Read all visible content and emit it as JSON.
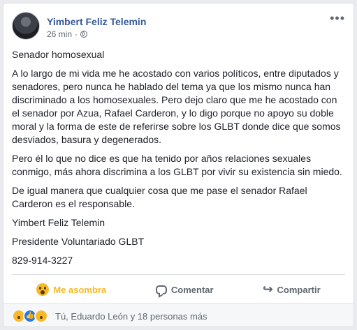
{
  "post": {
    "author": "Yimbert Feliz Telemin",
    "time": "26 min",
    "more": "•••",
    "paragraphs": [
      "Senador homosexual",
      "A lo largo de mi vida me he acostado con varios políticos, entre diputados y senadores, pero nunca he hablado del tema ya que los mismo nunca han discriminado a los homosexuales. Pero dejo claro que me he acostado con el senador por Azua, Rafael Carderon, y lo digo porque no apoyo su doble moral y la forma de este de referirse sobre los GLBT donde dice que somos desviados, basura y degenerados.",
      "Pero él lo que no dice es que ha tenido por años relaciones sexuales conmigo, más ahora discrimina a los GLBT por vivir su existencia sin miedo.",
      "De igual manera que cualquier cosa que me pase el senador Rafael Carderon es el responsable."
    ],
    "signature": [
      "Yimbert Feliz Telemin",
      "Presidente Voluntariado GLBT",
      "829-914-3227"
    ]
  },
  "actions": {
    "reaction_label": "Me asombra",
    "comment_label": "Comentar",
    "share_label": "Compartir"
  },
  "reactions_summary": "Tú, Eduardo León y 18 personas más",
  "colors": {
    "link": "#365899",
    "reaction": "#f7b928",
    "like": "#2078f4"
  }
}
